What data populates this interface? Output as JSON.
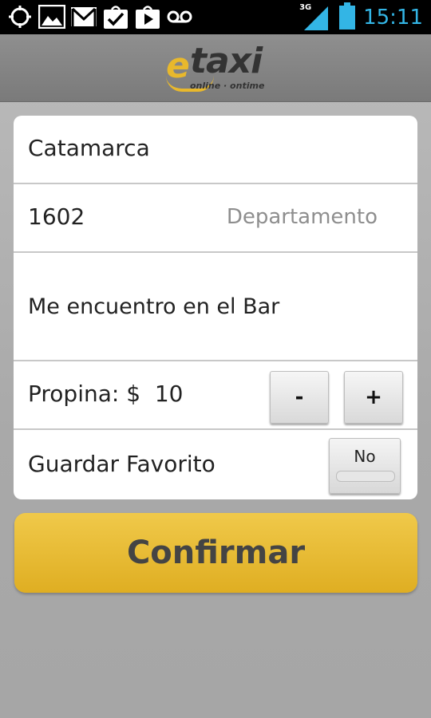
{
  "status_bar": {
    "time": "15:11",
    "network": "3G",
    "icons": [
      "gps-icon",
      "gallery-icon",
      "gmail-icon",
      "task-check-icon",
      "play-store-icon",
      "voicemail-icon",
      "signal-icon",
      "battery-icon"
    ]
  },
  "header": {
    "logo_text": "taxi",
    "logo_prefix": "e",
    "logo_tagline": "online · ontime"
  },
  "form": {
    "street": "Catamarca",
    "number": "1602",
    "apartment_placeholder": "Departamento",
    "note": "Me encuentro en el Bar",
    "tip_label": "Propina: $  10",
    "minus_label": "-",
    "plus_label": "+",
    "favorite_label": "Guardar Favorito",
    "favorite_toggle": "No"
  },
  "confirm_label": "Confirmar",
  "colors": {
    "accent": "#e8b82c",
    "status_blue": "#33b5e5"
  }
}
